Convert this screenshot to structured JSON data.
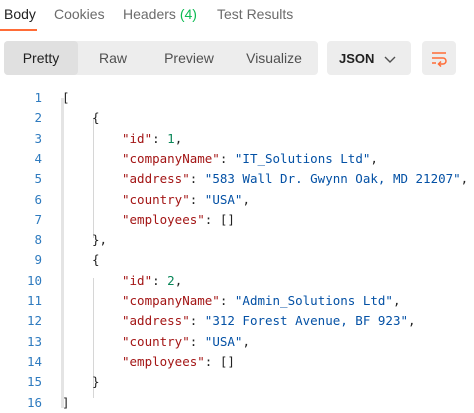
{
  "tabs": [
    {
      "label": "Body",
      "count": ""
    },
    {
      "label": "Cookies",
      "count": ""
    },
    {
      "label": "Headers",
      "count": "(4)"
    },
    {
      "label": "Test Results",
      "count": ""
    }
  ],
  "view_modes": [
    "Pretty",
    "Raw",
    "Preview",
    "Visualize"
  ],
  "language": "JSON",
  "code_lines": [
    {
      "n": "1",
      "indent": 0,
      "parts": [
        [
          "p",
          "["
        ]
      ]
    },
    {
      "n": "2",
      "indent": 1,
      "parts": [
        [
          "p",
          "{"
        ]
      ]
    },
    {
      "n": "3",
      "indent": 2,
      "parts": [
        [
          "k",
          "\"id\""
        ],
        [
          "p",
          ": "
        ],
        [
          "n",
          "1"
        ],
        [
          "p",
          ","
        ]
      ]
    },
    {
      "n": "4",
      "indent": 2,
      "parts": [
        [
          "k",
          "\"companyName\""
        ],
        [
          "p",
          ": "
        ],
        [
          "s",
          "\"IT_Solutions Ltd\""
        ],
        [
          "p",
          ","
        ]
      ]
    },
    {
      "n": "5",
      "indent": 2,
      "parts": [
        [
          "k",
          "\"address\""
        ],
        [
          "p",
          ": "
        ],
        [
          "s",
          "\"583 Wall Dr. Gwynn Oak, MD 21207\""
        ],
        [
          "p",
          ","
        ]
      ]
    },
    {
      "n": "6",
      "indent": 2,
      "parts": [
        [
          "k",
          "\"country\""
        ],
        [
          "p",
          ": "
        ],
        [
          "s",
          "\"USA\""
        ],
        [
          "p",
          ","
        ]
      ]
    },
    {
      "n": "7",
      "indent": 2,
      "parts": [
        [
          "k",
          "\"employees\""
        ],
        [
          "p",
          ": []"
        ]
      ]
    },
    {
      "n": "8",
      "indent": 1,
      "parts": [
        [
          "p",
          "},"
        ]
      ]
    },
    {
      "n": "9",
      "indent": 1,
      "parts": [
        [
          "p",
          "{"
        ]
      ]
    },
    {
      "n": "10",
      "indent": 2,
      "parts": [
        [
          "k",
          "\"id\""
        ],
        [
          "p",
          ": "
        ],
        [
          "n",
          "2"
        ],
        [
          "p",
          ","
        ]
      ]
    },
    {
      "n": "11",
      "indent": 2,
      "parts": [
        [
          "k",
          "\"companyName\""
        ],
        [
          "p",
          ": "
        ],
        [
          "s",
          "\"Admin_Solutions Ltd\""
        ],
        [
          "p",
          ","
        ]
      ]
    },
    {
      "n": "12",
      "indent": 2,
      "parts": [
        [
          "k",
          "\"address\""
        ],
        [
          "p",
          ": "
        ],
        [
          "s",
          "\"312 Forest Avenue, BF 923\""
        ],
        [
          "p",
          ","
        ]
      ]
    },
    {
      "n": "13",
      "indent": 2,
      "parts": [
        [
          "k",
          "\"country\""
        ],
        [
          "p",
          ": "
        ],
        [
          "s",
          "\"USA\""
        ],
        [
          "p",
          ","
        ]
      ]
    },
    {
      "n": "14",
      "indent": 2,
      "parts": [
        [
          "k",
          "\"employees\""
        ],
        [
          "p",
          ": []"
        ]
      ]
    },
    {
      "n": "15",
      "indent": 1,
      "parts": [
        [
          "p",
          "}"
        ]
      ]
    },
    {
      "n": "16",
      "indent": 0,
      "parts": [
        [
          "p",
          "]"
        ]
      ]
    }
  ],
  "colors": {
    "accent": "#ff6c37",
    "count": "#0cbb52",
    "key": "#a31515",
    "string": "#0451a5",
    "number": "#098658",
    "line_number": "#2f7bbf"
  },
  "icons": {
    "language_chevron": "chevron-down-icon",
    "wrap": "wrap-lines-icon"
  }
}
